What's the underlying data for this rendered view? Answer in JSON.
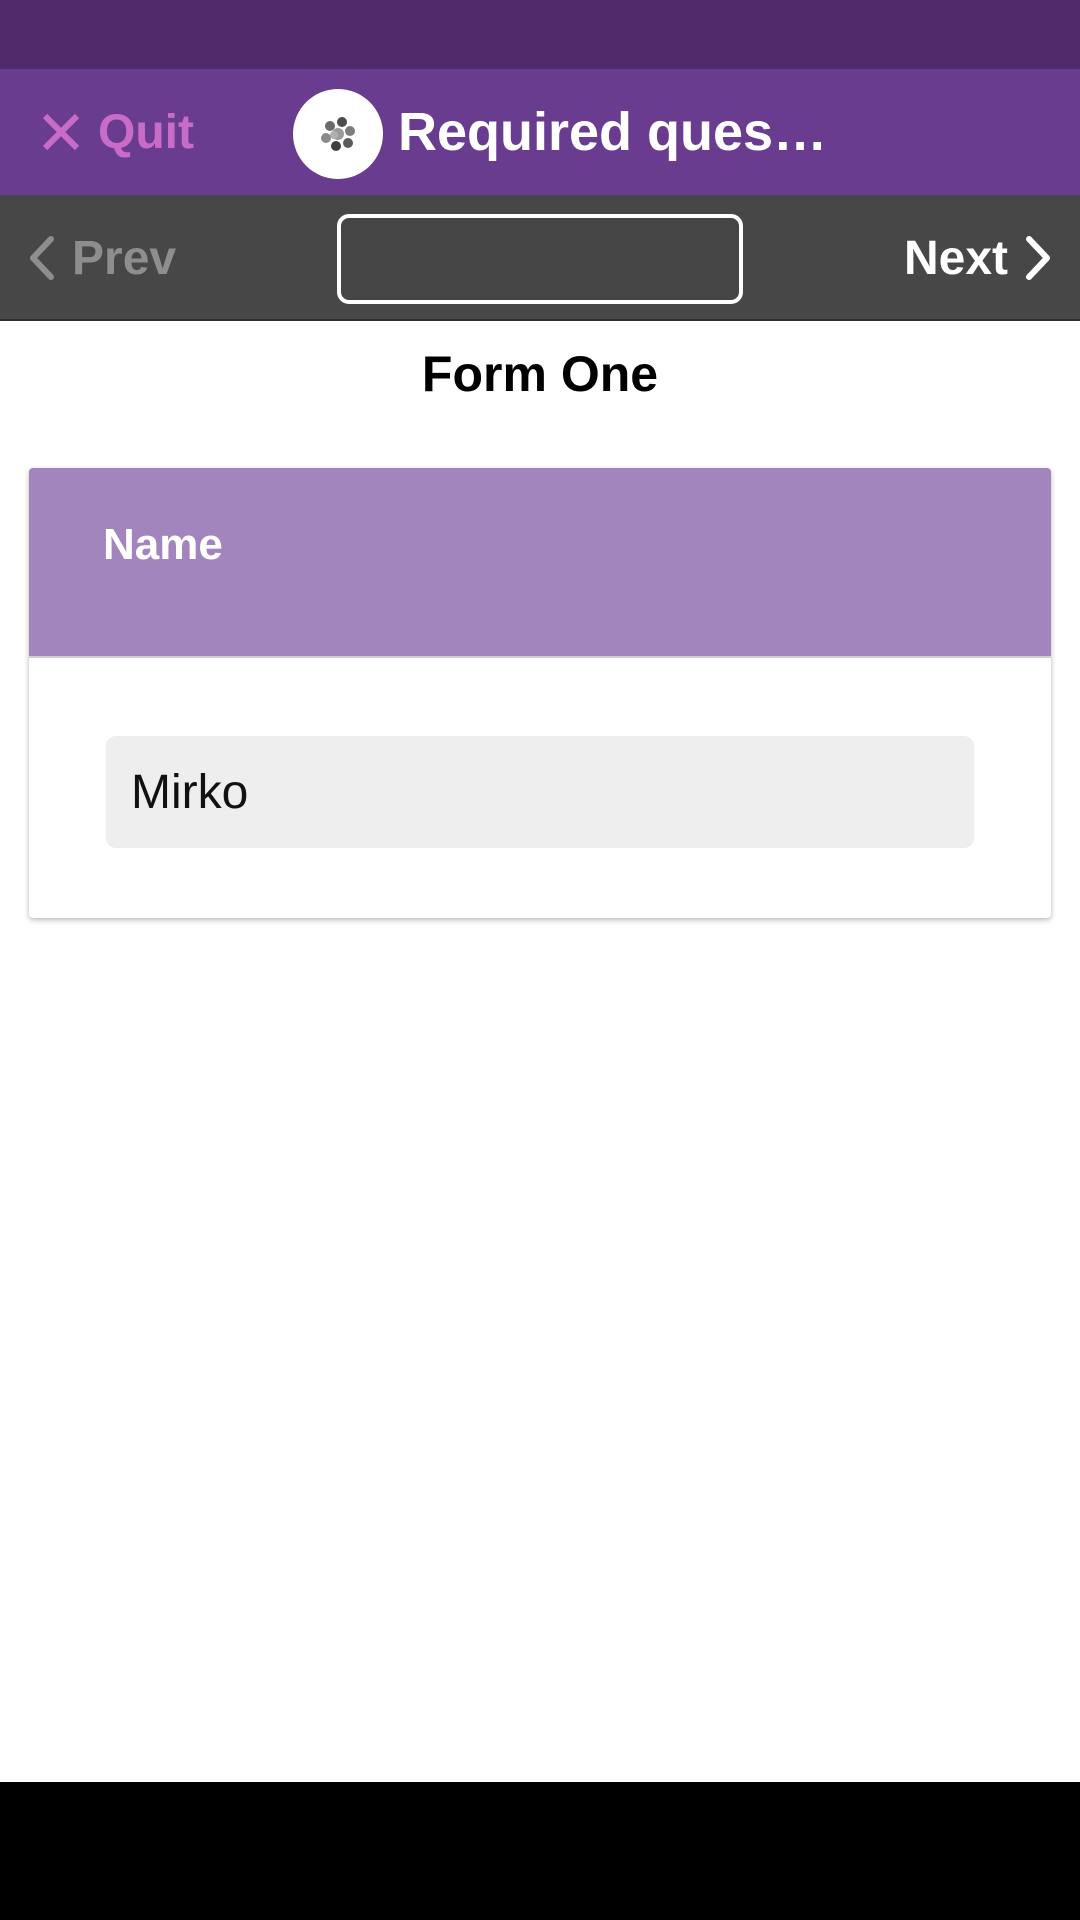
{
  "colors": {
    "status_bar": "#4e2c6c",
    "app_bar": "#693c90",
    "quit_accent": "#c86cc8",
    "nav_bar": "#474747",
    "card_header": "#a385be",
    "input_bg": "#eeeeee"
  },
  "app_bar": {
    "quit_label": "Quit",
    "quit_icon": "close-icon",
    "logo_icon": "app-logo-icon",
    "title": "Required ques…"
  },
  "nav_bar": {
    "prev_label": "Prev",
    "prev_icon": "chevron-left-icon",
    "jump_input_value": "",
    "next_label": "Next",
    "next_icon": "chevron-right-icon"
  },
  "form": {
    "title": "Form One",
    "question": {
      "label": "Name",
      "answer_value": "Mirko"
    }
  }
}
